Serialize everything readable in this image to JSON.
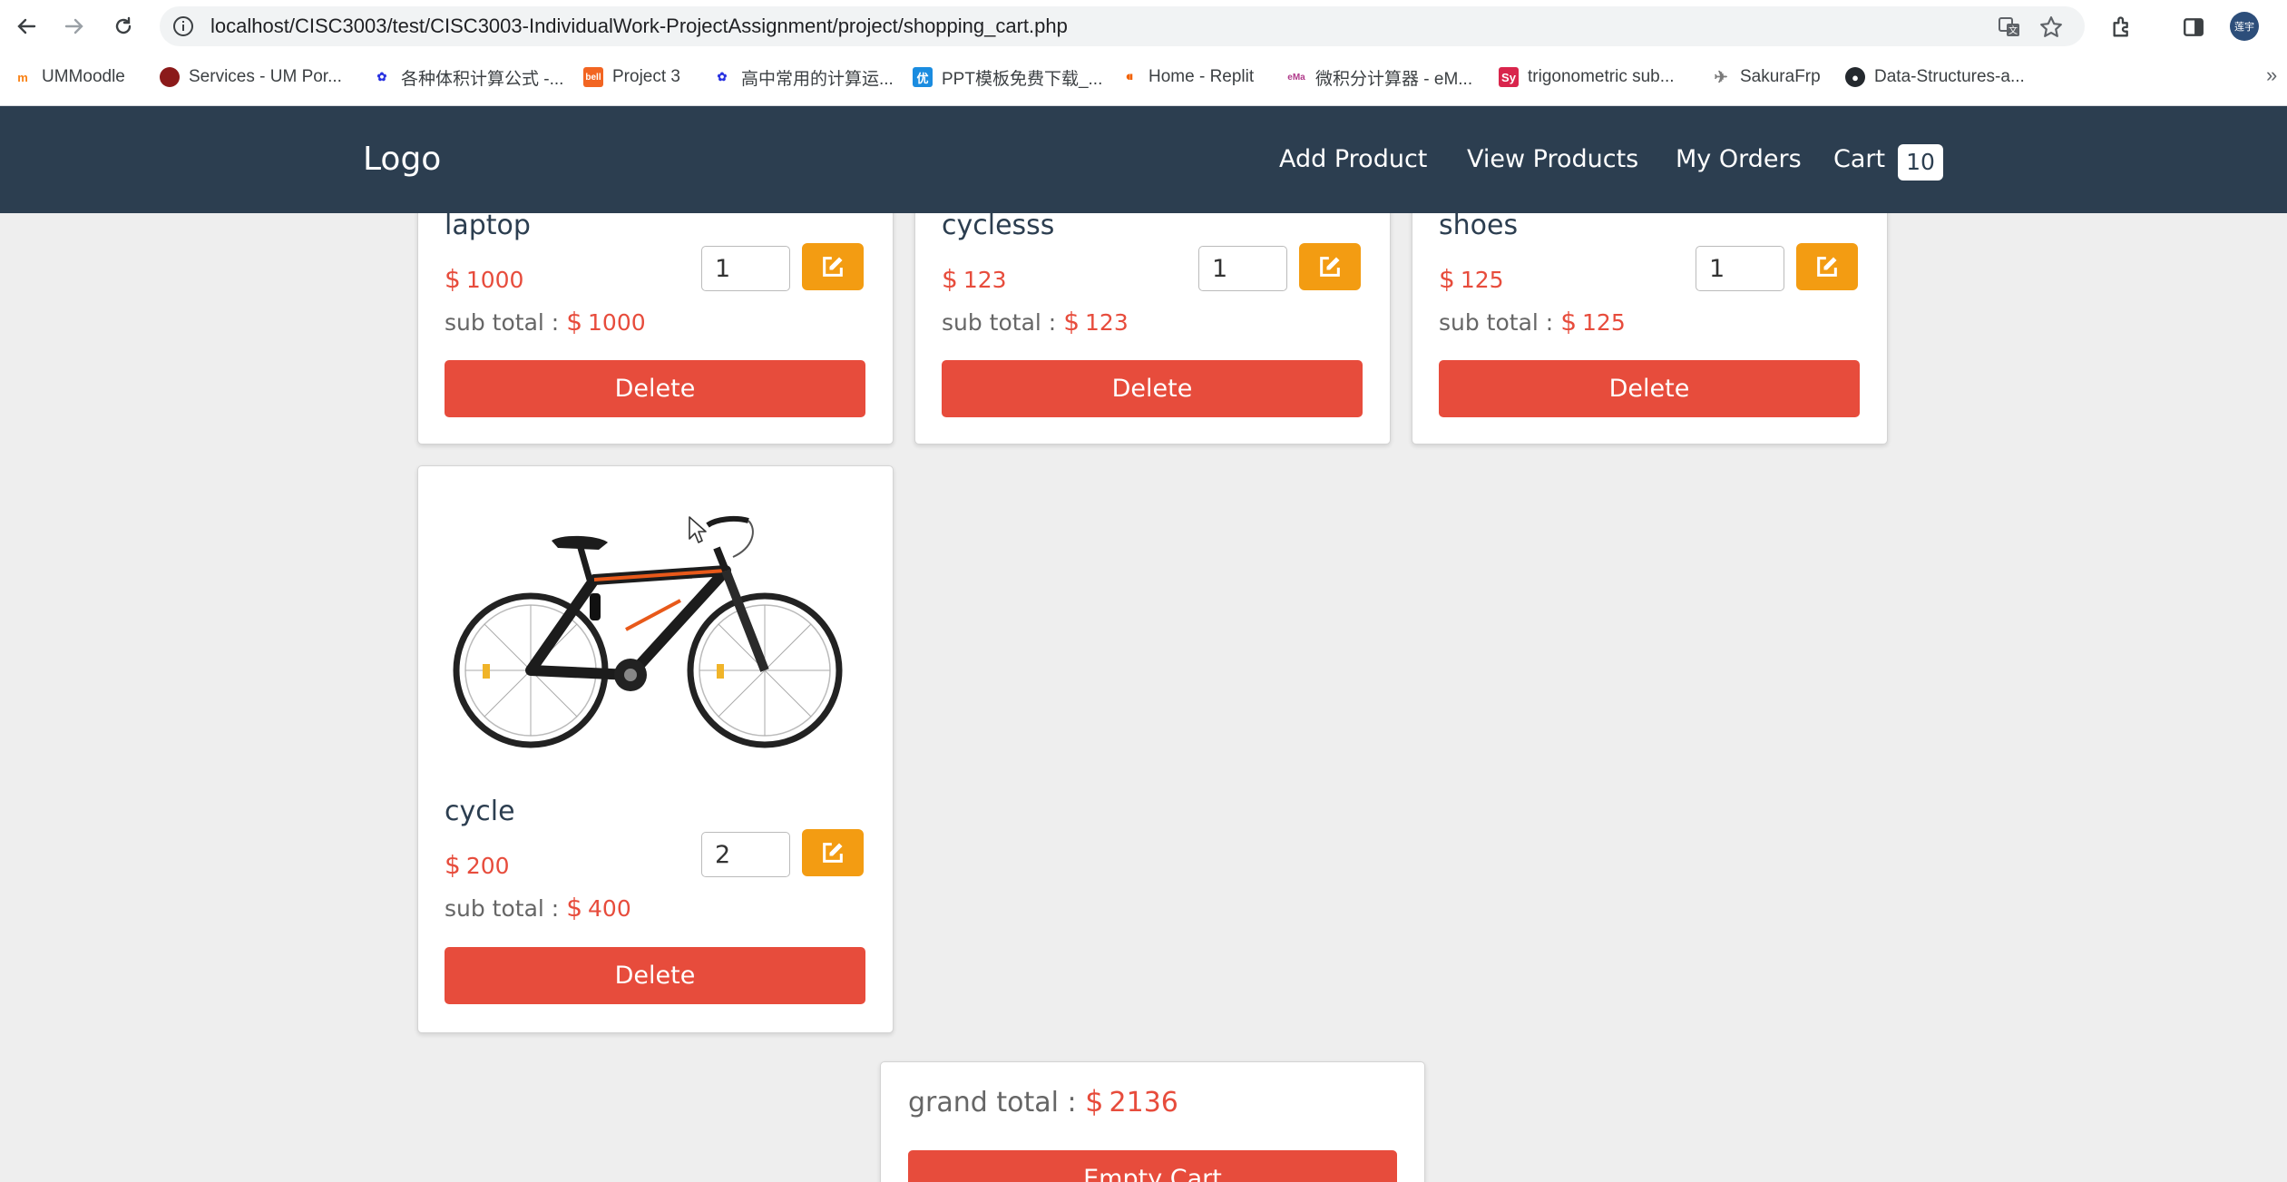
{
  "browser": {
    "url": "localhost/CISC3003/test/CISC3003-IndividualWork-ProjectAssignment/project/shopping_cart.php",
    "profile_initials": "莲宇",
    "bookmarks": [
      {
        "label": "UMMoodle",
        "icon": "moodle-icon",
        "color": "#f98012"
      },
      {
        "label": "Services - UM Por...",
        "icon": "um-portal-icon",
        "color": "#8b1a1a"
      },
      {
        "label": "各种体积计算公式 -...",
        "icon": "baidu-icon",
        "color": "#2932e1"
      },
      {
        "label": "Project 3",
        "icon": "project-icon",
        "color": "#f26522"
      },
      {
        "label": "高中常用的计算运...",
        "icon": "baidu-icon",
        "color": "#2932e1"
      },
      {
        "label": "PPT模板免费下载_...",
        "icon": "youppt-icon",
        "color": "#1a8ce0"
      },
      {
        "label": "Home - Replit",
        "icon": "replit-icon",
        "color": "#f26207"
      },
      {
        "label": "微积分计算器 - eM...",
        "icon": "emath-icon",
        "color": "#b03a8a"
      },
      {
        "label": "trigonometric sub...",
        "icon": "symbolab-icon",
        "color": "#d9254c"
      },
      {
        "label": "SakuraFrp",
        "icon": "sakurafrp-icon",
        "color": "#7a7a7a"
      },
      {
        "label": "Data-Structures-a...",
        "icon": "github-icon",
        "color": "#24292e"
      }
    ]
  },
  "header": {
    "logo": "Logo",
    "nav": {
      "add_product": "Add Product",
      "view_products": "View Products",
      "my_orders": "My Orders",
      "cart": "Cart",
      "cart_count": "10"
    }
  },
  "cart": {
    "currency": "$",
    "subtotal_label": "sub total :",
    "delete_label": "Delete",
    "items": [
      {
        "name": "laptop",
        "price": "1000",
        "qty": "1",
        "subtotal": "1000"
      },
      {
        "name": "cyclesss",
        "price": "123",
        "qty": "1",
        "subtotal": "123"
      },
      {
        "name": "shoes",
        "price": "125",
        "qty": "1",
        "subtotal": "125"
      },
      {
        "name": "cycle",
        "price": "200",
        "qty": "2",
        "subtotal": "400"
      }
    ],
    "grand_total_label": "grand total :",
    "grand_total": "2136",
    "empty_cart_label": "Empty Cart"
  },
  "colors": {
    "header_bg": "#2c3e50",
    "accent_red": "#e74c3c",
    "edit_orange": "#f39c12"
  }
}
